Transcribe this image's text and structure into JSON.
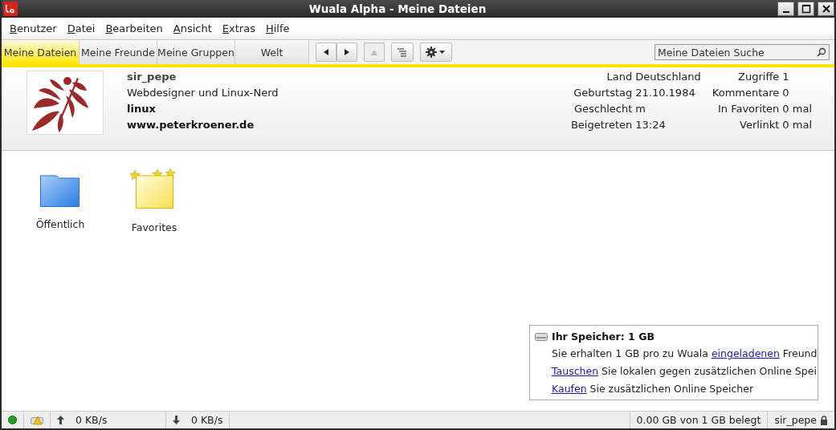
{
  "window": {
    "title": "Wuala Alpha - Meine Dateien"
  },
  "menu": [
    "Benutzer",
    "Datei",
    "Bearbeiten",
    "Ansicht",
    "Extras",
    "Hilfe"
  ],
  "tabs": [
    {
      "label": "Meine Dateien",
      "selected": true
    },
    {
      "label": "Meine Freunde",
      "selected": false
    },
    {
      "label": "Meine Gruppen",
      "selected": false
    },
    {
      "label": "Welt",
      "selected": false
    }
  ],
  "toolbar": [
    {
      "kind": "back",
      "disabled": false
    },
    {
      "kind": "forward",
      "disabled": false
    },
    {
      "kind": "up",
      "disabled": true
    },
    {
      "kind": "list",
      "disabled": false
    },
    {
      "kind": "gear",
      "disabled": false
    }
  ],
  "search": {
    "value": "Meine Dateien Suche"
  },
  "profile": {
    "name": "sir_pepe",
    "tagline": "Webdesigner und Linux-Nerd",
    "keyword": "linux",
    "website": "www.peterkroener.de",
    "details": [
      {
        "label": "Land",
        "value": "Deutschland"
      },
      {
        "label": "Geburtstag",
        "value": "21.10.1984"
      },
      {
        "label": "Geschlecht",
        "value": "m"
      },
      {
        "label": "Beigetreten",
        "value": "13:24"
      }
    ],
    "stats": [
      {
        "label": "Zugriffe",
        "value": "1"
      },
      {
        "label": "Kommentare",
        "value": "0"
      },
      {
        "label": "In Favoriten",
        "value": "0 mal"
      },
      {
        "label": "Verlinkt",
        "value": "0 mal"
      }
    ]
  },
  "folders": [
    {
      "kind": "public",
      "label": "Öffentlich"
    },
    {
      "kind": "favorites",
      "label": "Favorites"
    }
  ],
  "storage": {
    "title": "Ihr Speicher: 1 GB",
    "lines": [
      [
        {
          "text": "Sie erhalten 1 GB pro zu Wuala ",
          "link": false
        },
        {
          "text": "eingeladenen",
          "link": true
        },
        {
          "text": " Freund",
          "link": false
        }
      ],
      [
        {
          "text": "Tauschen",
          "link": true
        },
        {
          "text": " Sie lokalen gegen zusätzlichen Online Spei",
          "link": false
        }
      ],
      [
        {
          "text": "Kaufen",
          "link": true
        },
        {
          "text": " Sie zusätzlichen Online Speicher",
          "link": false
        }
      ]
    ]
  },
  "status_bar": {
    "upload": "0 KB/s",
    "download": "0 KB/s",
    "usage": "0.00 GB von 1 GB belegt",
    "user": "sir_pepe"
  }
}
